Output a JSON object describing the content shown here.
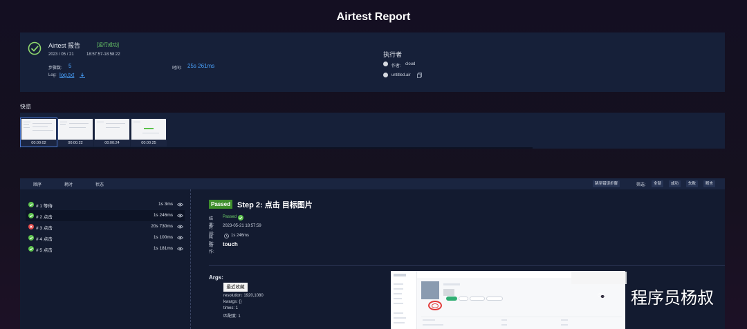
{
  "report_title": "Airtest Report",
  "summary": {
    "name": "Airtest 报告",
    "status": "[运行成功]",
    "date": "2023 / 05 / 21",
    "time_range": "18:57:57-18:58:22",
    "steps_label": "步骤数:",
    "steps_value": "5",
    "duration_label": "时间:",
    "duration_value": "25s 261ms",
    "log_label": "Log:",
    "log_link": "log.txt"
  },
  "executor": {
    "title": "执行者",
    "author_label": "作者:",
    "author_value": "cloud",
    "script": "untitled.air"
  },
  "overview": {
    "label": "快览",
    "thumbs": [
      "00:00:02",
      "00:00:22",
      "00:00:24",
      "00:00:25"
    ]
  },
  "steps_header": {
    "col_order": "顺序",
    "col_duration": "耗时",
    "col_status": "状态",
    "jump_error": "跳至错误步骤",
    "filter_label": "筛选:",
    "filter_all": "全部",
    "filter_success": "成功",
    "filter_fail": "失败",
    "filter_assert": "断言"
  },
  "steps": [
    {
      "name": "# 1 等待",
      "time": "1s 3ms",
      "status": "ok"
    },
    {
      "name": "# 2 点击",
      "time": "1s 246ms",
      "status": "ok"
    },
    {
      "name": "# 3 点击",
      "time": "20s 730ms",
      "status": "fail"
    },
    {
      "name": "# 4 点击",
      "time": "1s 100ms",
      "status": "ok"
    },
    {
      "name": "# 5 点击",
      "time": "1s 181ms",
      "status": "ok"
    }
  ],
  "detail": {
    "badge": "Passed",
    "title": "Step 2: 点击 目标图片",
    "result_label": "结果:",
    "result_value": "Passed",
    "time_label": "时间:",
    "time_value": "2023-05-21 18:57:59",
    "cost_label": "耗时:",
    "cost_value": "1s 246ms",
    "action_label": "动作:",
    "action_value": "touch",
    "args_label": "Args:",
    "target_text": "最近收藏",
    "arg_resolution": "resolution: 1920,1080",
    "arg_kwargs": "kwargs: {}",
    "arg_times": "times: 1",
    "arg_threshold": "匹配度: 1"
  },
  "watermark": "程序员杨叔",
  "colors": {
    "success": "#5cc24c",
    "fail": "#e24a4a",
    "link": "#4aa3ff",
    "panel": "#162039"
  }
}
